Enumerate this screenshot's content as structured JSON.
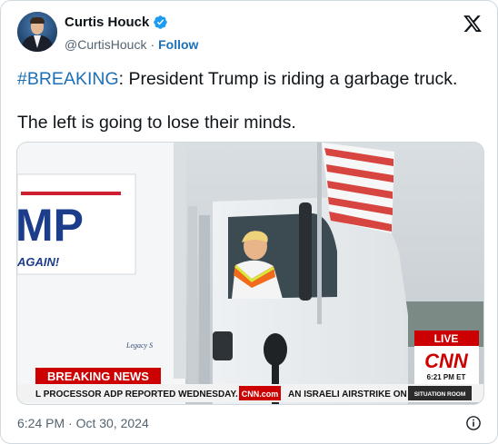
{
  "author": {
    "name": "Curtis Houck",
    "handle": "@CurtisHouck",
    "separator": "·",
    "follow_label": "Follow"
  },
  "tweet": {
    "hashtag": "#BREAKING",
    "line1_rest": ": President Trump is riding a garbage truck.",
    "line2": "The left is going to lose their minds."
  },
  "media": {
    "sign_big": "MP",
    "sign_small": "AGAIN!",
    "truck_logo": "Legacy S",
    "live_label": "LIVE",
    "network": "CNN",
    "time": "6:21 PM ET",
    "breaking_label": "BREAKING NEWS",
    "ticker_left": "L PROCESSOR ADP REPORTED WEDNESDAY.",
    "ticker_logo": "CNN.com",
    "ticker_right": "AN ISRAELI AIRSTRIKE ON A",
    "ticker_tag": "SITUATION ROOM"
  },
  "timestamp": "6:24 PM · Oct 30, 2024",
  "colors": {
    "link_blue": "#1d70b8",
    "verified_blue": "#1d9bf0",
    "cnn_red": "#cc0000"
  },
  "icons": {
    "verified": "verified-badge-icon",
    "x_logo": "x-logo-icon",
    "info": "info-icon"
  }
}
